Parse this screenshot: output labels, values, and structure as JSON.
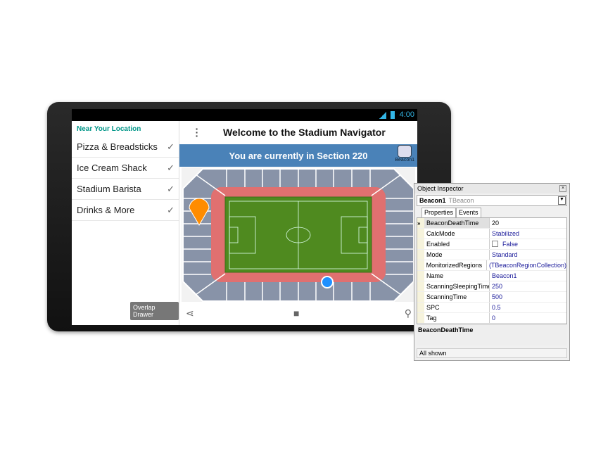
{
  "status": {
    "time": "4:00"
  },
  "drawer": {
    "header": "Near Your Location",
    "items": [
      {
        "label": "Pizza & Breadsticks"
      },
      {
        "label": "Ice Cream Shack"
      },
      {
        "label": "Stadium Barista"
      },
      {
        "label": "Drinks & More"
      }
    ],
    "overlay_button": "Overlap Drawer"
  },
  "appbar": {
    "title": "Welcome to the Stadium Navigator"
  },
  "banner": {
    "text": "You are currently in Section 220",
    "beacon_label": "Beacon1"
  },
  "map": {
    "marker_color": "#ff8c00",
    "location_color": "#1e90ff",
    "pitch_color": "#4f8a1f",
    "lower_ring_color": "#e07070",
    "seats_color": "#8893a8"
  },
  "inspector": {
    "title": "Object Inspector",
    "object_name": "Beacon1",
    "object_type": "TBeacon",
    "tabs": [
      "Properties",
      "Events"
    ],
    "properties": [
      {
        "key": "BeaconDeathTime",
        "value": "20"
      },
      {
        "key": "CalcMode",
        "value": "Stabilized"
      },
      {
        "key": "Enabled",
        "value": "False"
      },
      {
        "key": "Mode",
        "value": "Standard"
      },
      {
        "key": "MonitorizedRegions",
        "value": "(TBeaconRegionCollection)"
      },
      {
        "key": "Name",
        "value": "Beacon1"
      },
      {
        "key": "ScanningSleepingTime",
        "value": "250"
      },
      {
        "key": "ScanningTime",
        "value": "500"
      },
      {
        "key": "SPC",
        "value": "0.5"
      },
      {
        "key": "Tag",
        "value": "0"
      }
    ],
    "description": "BeaconDeathTime",
    "footer": "All shown"
  }
}
